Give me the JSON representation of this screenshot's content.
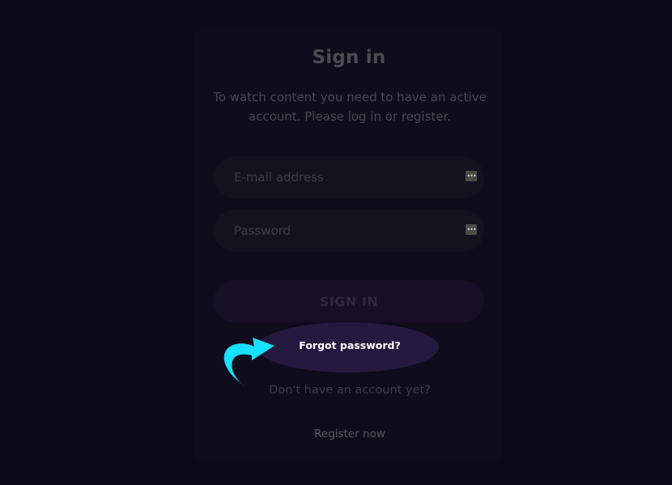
{
  "signin": {
    "title": "Sign in",
    "subtitle": "To watch content you need to have an active account. Please log in or register.",
    "email": {
      "placeholder": "E-mail address",
      "value": ""
    },
    "password": {
      "placeholder": "Password",
      "value": ""
    },
    "password_manager_icon": "ellipsis-key-icon",
    "submit_label": "SIGN IN",
    "forgot_label": "Forgot password?",
    "no_account_text": "Don't have an account yet?",
    "register_label": "Register now"
  },
  "annotation": {
    "arrow_icon": "curved-arrow-icon",
    "arrow_color": "#18e0ff",
    "highlight_color": "#241a40"
  },
  "colors": {
    "background": "#0d0b1a",
    "card": "#0f0d1c",
    "field": "#14121f",
    "button": "#160f26"
  }
}
